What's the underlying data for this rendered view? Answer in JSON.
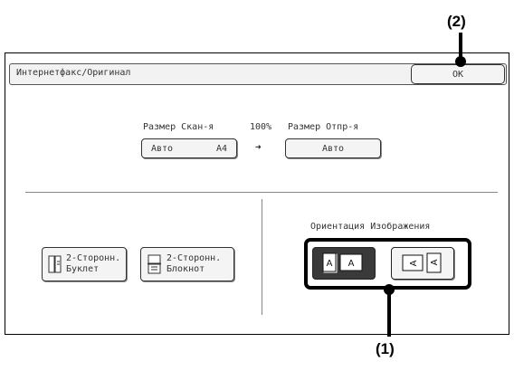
{
  "window": {
    "title": "Интернетфакс/Оригинал",
    "ok_label": "OK"
  },
  "scan": {
    "label": "Размер Скан-я",
    "mode": "Авто",
    "size": "A4"
  },
  "ratio": "100%",
  "send": {
    "label": "Размер Отпр-я",
    "value": "Авто"
  },
  "duplex": {
    "booklet": {
      "line1": "2-Сторонн.",
      "line2": "Буклет"
    },
    "tablet": {
      "line1": "2-Сторонн.",
      "line2": "Блокнот"
    }
  },
  "orientation": {
    "label": "Ориентация Изображения",
    "selected": "portrait",
    "icon_letter": "A"
  },
  "callouts": {
    "one": "(1)",
    "two": "(2)"
  }
}
